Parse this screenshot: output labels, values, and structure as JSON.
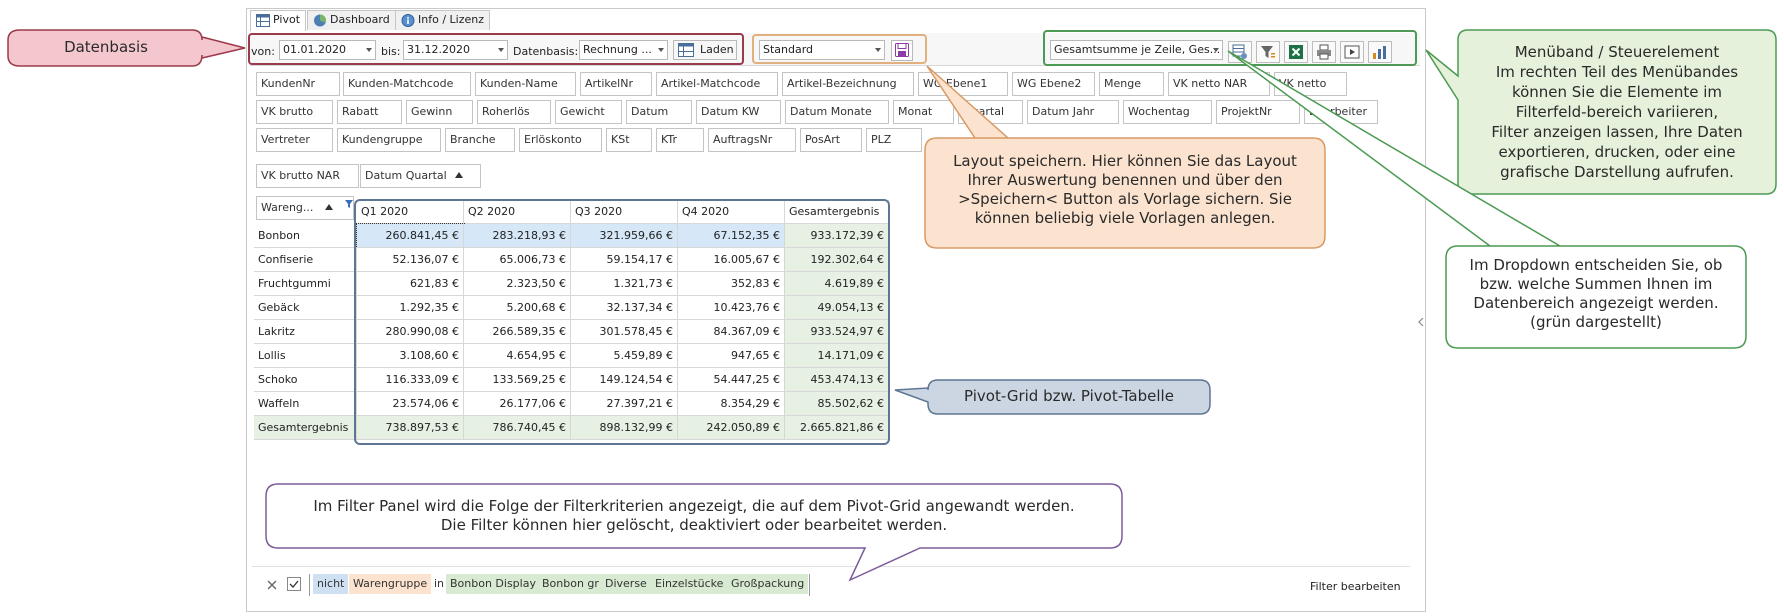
{
  "tabs": [
    {
      "label": "Pivot",
      "icon": "pivot-icon"
    },
    {
      "label": "Dashboard",
      "icon": "dashboard-icon"
    },
    {
      "label": "Info / Lizenz",
      "icon": "info-icon"
    }
  ],
  "toolbar": {
    "von_label": "von:",
    "von_value": "01.01.2020",
    "bis_label": "bis:",
    "bis_value": "31.12.2020",
    "datenbasis_label": "Datenbasis:",
    "datenbasis_value": "Rechnung ...",
    "laden_label": "Laden",
    "layout_value": "Standard",
    "summen_value": "Gesamtsumme je Zeile, Ges..."
  },
  "fields": {
    "row1": [
      "KundenNr",
      "Kunden-Matchcode",
      "Kunden-Name",
      "ArtikelNr",
      "Artikel-Matchcode",
      "Artikel-Bezeichnung",
      "WG Ebene1",
      "WG Ebene2",
      "Menge",
      "VK netto NAR",
      "VK netto"
    ],
    "row2": [
      "VK brutto",
      "Rabatt",
      "Gewinn",
      "Roherlös",
      "Gewicht",
      "Datum",
      "Datum KW",
      "Datum Monate",
      "Monat",
      "Quartal",
      "Datum Jahr",
      "Wochentag",
      "ProjektNr",
      "Bearbeiter"
    ],
    "row3": [
      "Vertreter",
      "Kundengruppe",
      "Branche",
      "Erlöskonto",
      "KSt",
      "KTr",
      "AuftragsNr",
      "PosArt",
      "PLZ"
    ],
    "column_area": [
      "VK brutto NAR",
      "Datum Quartal"
    ],
    "row_area": "Wareng..."
  },
  "grid": {
    "columns": [
      "Q1 2020",
      "Q2 2020",
      "Q3 2020",
      "Q4 2020",
      "Gesamtergebnis"
    ],
    "rows": [
      {
        "label": "Bonbon",
        "values": [
          "260.841,45 €",
          "283.218,93 €",
          "321.959,66 €",
          "67.152,35 €",
          "933.172,39 €"
        ]
      },
      {
        "label": "Confiserie",
        "values": [
          "52.136,07 €",
          "65.006,73 €",
          "59.154,17 €",
          "16.005,67 €",
          "192.302,64 €"
        ]
      },
      {
        "label": "Fruchtgummi",
        "values": [
          "621,83 €",
          "2.323,50 €",
          "1.321,73 €",
          "352,83 €",
          "4.619,89 €"
        ]
      },
      {
        "label": "Gebäck",
        "values": [
          "1.292,35 €",
          "5.200,68 €",
          "32.137,34 €",
          "10.423,76 €",
          "49.054,13 €"
        ]
      },
      {
        "label": "Lakritz",
        "values": [
          "280.990,08 €",
          "266.589,35 €",
          "301.578,45 €",
          "84.367,09 €",
          "933.524,97 €"
        ]
      },
      {
        "label": "Lollis",
        "values": [
          "3.108,60 €",
          "4.654,95 €",
          "5.459,89 €",
          "947,65 €",
          "14.171,09 €"
        ]
      },
      {
        "label": "Schoko",
        "values": [
          "116.333,09 €",
          "133.569,25 €",
          "149.124,54 €",
          "54.447,25 €",
          "453.474,13 €"
        ]
      },
      {
        "label": "Waffeln",
        "values": [
          "23.574,06 €",
          "26.177,06 €",
          "27.397,21 €",
          "8.354,29 €",
          "85.502,62 €"
        ]
      },
      {
        "label": "Gesamtergebnis",
        "values": [
          "738.897,53 €",
          "786.740,45 €",
          "898.132,99 €",
          "242.050,89 €",
          "2.665.821,86 €"
        ]
      }
    ]
  },
  "filter_panel": {
    "nicht": "nicht",
    "field": "Warengruppe",
    "in": "in",
    "values": [
      "Bonbon Display",
      "Bonbon gr",
      "Diverse",
      "Einzelstücke",
      "Großpackung"
    ],
    "edit_label": "Filter bearbeiten"
  },
  "callouts": {
    "datenbasis": "Datenbasis",
    "menueband": [
      "Menüband / Steuerelement",
      "Im rechten Teil des Menübandes",
      "können Sie die Elemente im",
      "Filterfeld-bereich variieren,",
      "Filter anzeigen lassen, Ihre Daten",
      "exportieren, drucken, oder eine",
      "grafische Darstellung aufrufen."
    ],
    "layout": [
      "Layout speichern. Hier können Sie das Layout",
      "Ihrer Auswertung benennen und über den",
      ">Speichern< Button als Vorlage sichern. Sie",
      "können beliebig viele Vorlagen anlegen."
    ],
    "dropdown": [
      "Im Dropdown entscheiden Sie, ob",
      "bzw. welche Summen Ihnen im",
      "Datenbereich angezeigt werden.",
      "(grün dargestellt)"
    ],
    "pivotgrid": "Pivot-Grid bzw. Pivot-Tabelle",
    "filterpanel": [
      "Im Filter Panel wird die Folge der Filterkriterien angezeigt, die auf dem Pivot-Grid angewandt werden.",
      "Die Filter können hier gelöscht, deaktiviert oder bearbeitet werden."
    ]
  },
  "colors": {
    "datenbasis_fill": "#f4c7cf",
    "datenbasis_border": "#9b3a4a",
    "green_fill": "#e6f1dc",
    "green_border": "#4c9a53",
    "orange_fill": "#fbe3cf",
    "orange_border": "#d79a66",
    "blue_fill": "#cbd6e2",
    "blue_border": "#5d7694",
    "purple_border": "#7b5b9a"
  }
}
